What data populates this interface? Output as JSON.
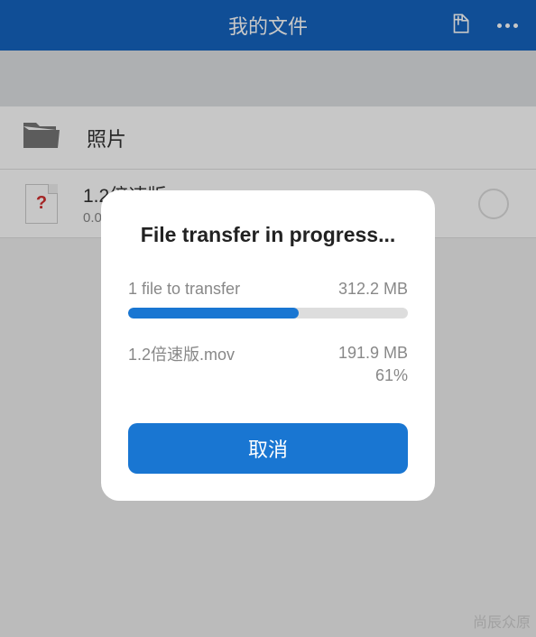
{
  "header": {
    "title": "我的文件"
  },
  "list": {
    "folder": {
      "label": "照片"
    },
    "file": {
      "name": "1.2倍速版.mov",
      "size": "0.00 Bytes",
      "icon_mark": "?"
    }
  },
  "dialog": {
    "title": "File transfer in progress...",
    "count_text": "1 file to transfer",
    "total_size": "312.2 MB",
    "current_file": "1.2倍速版.mov",
    "transferred": "191.9 MB",
    "percent": "61%",
    "progress_value": 61,
    "cancel_label": "取消"
  },
  "watermark": "尚辰众原"
}
